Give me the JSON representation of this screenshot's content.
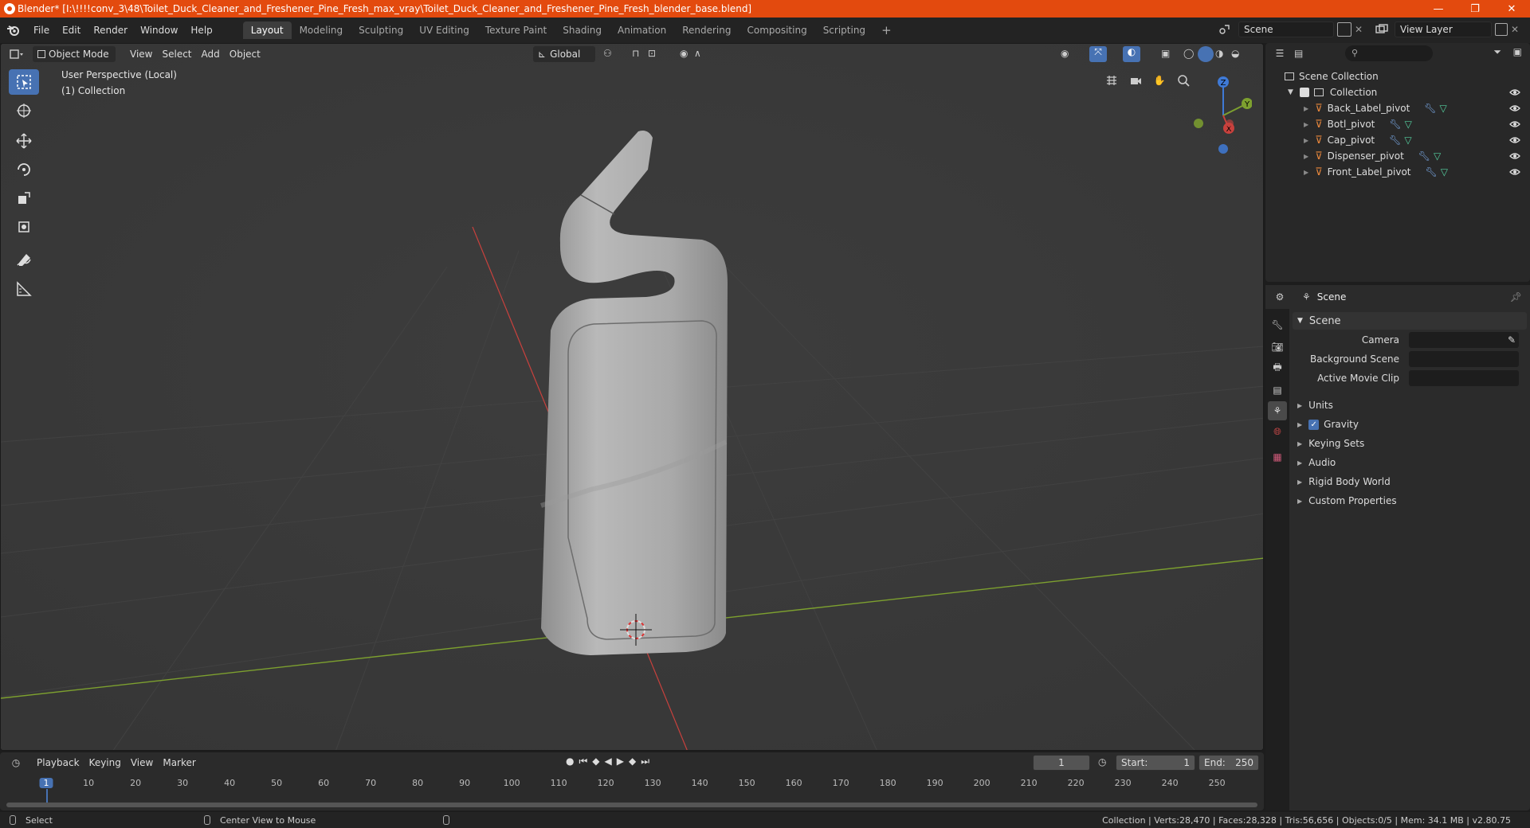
{
  "window": {
    "title": "Blender* [I:\\!!!!conv_3\\48\\Toilet_Duck_Cleaner_and_Freshener_Pine_Fresh_max_vray\\Toilet_Duck_Cleaner_and_Freshener_Pine_Fresh_blender_base.blend]",
    "minimize": "—",
    "maximize": "❐",
    "close": "✕"
  },
  "menu": {
    "items": [
      "File",
      "Edit",
      "Render",
      "Window",
      "Help"
    ],
    "workspaces": [
      "Layout",
      "Modeling",
      "Sculpting",
      "UV Editing",
      "Texture Paint",
      "Shading",
      "Animation",
      "Rendering",
      "Compositing",
      "Scripting"
    ],
    "active_workspace": "Layout",
    "add_tab": "+",
    "scene": "Scene",
    "view_layer": "View Layer"
  },
  "viewport": {
    "mode": "Object Mode",
    "menus": [
      "View",
      "Select",
      "Add",
      "Object"
    ],
    "orientation": "Global",
    "perspective_label": "User Perspective (Local)",
    "collection_label": "(1) Collection",
    "gizmo": {
      "x": "X",
      "y": "Y",
      "z": "Z"
    },
    "colors": {
      "x_axis": "#c8413d",
      "y_axis": "#7da02f",
      "z_axis": "#3f7ad6",
      "bg": "#3a3a3a"
    }
  },
  "tools": [
    "select-box",
    "cursor",
    "move",
    "rotate",
    "scale",
    "transform",
    "annotate",
    "measure"
  ],
  "outliner": {
    "root": "Scene Collection",
    "collection": "Collection",
    "objects": [
      {
        "name": "Back_Label_pivot"
      },
      {
        "name": "Botl_pivot"
      },
      {
        "name": "Cap_pivot"
      },
      {
        "name": "Dispenser_pivot"
      },
      {
        "name": "Front_Label_pivot"
      }
    ]
  },
  "properties": {
    "header": "Scene",
    "panel": "Scene",
    "fields": [
      {
        "label": "Camera"
      },
      {
        "label": "Background Scene"
      },
      {
        "label": "Active Movie Clip"
      }
    ],
    "sections": [
      "Units",
      "Gravity",
      "Keying Sets",
      "Audio",
      "Rigid Body World",
      "Custom Properties"
    ]
  },
  "timeline": {
    "menus": [
      "Playback",
      "Keying",
      "View",
      "Marker"
    ],
    "current_frame": "1",
    "start_label": "Start:",
    "start": "1",
    "end_label": "End:",
    "end": "250",
    "ticks": [
      "1",
      "10",
      "20",
      "30",
      "40",
      "50",
      "60",
      "70",
      "80",
      "90",
      "100",
      "110",
      "120",
      "130",
      "140",
      "150",
      "160",
      "170",
      "180",
      "190",
      "200",
      "210",
      "220",
      "230",
      "240",
      "250"
    ]
  },
  "status": {
    "left": "Select",
    "middle": "Center View to Mouse",
    "right": "Collection | Verts:28,470 | Faces:28,328 | Tris:56,656 | Objects:0/5 | Mem: 34.1 MB | v2.80.75"
  }
}
